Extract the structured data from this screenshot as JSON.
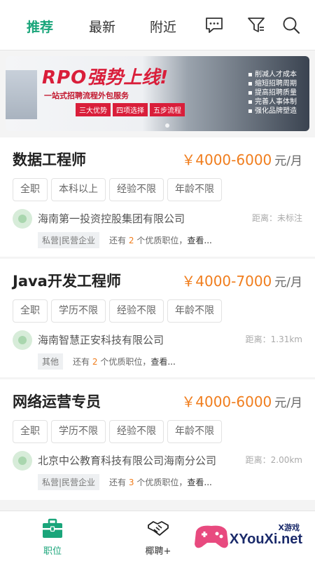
{
  "tabs": [
    {
      "label": "推荐",
      "active": true
    },
    {
      "label": "最新",
      "active": false
    },
    {
      "label": "附近",
      "active": false
    }
  ],
  "toolbar_icons": [
    "chat-icon",
    "filter-icon",
    "search-icon"
  ],
  "banner": {
    "title_latin": "RPO",
    "title_cn": "强势上线!",
    "subtitle": "一站式招聘流程外包服务",
    "pills": [
      "三大优势",
      "四项选择",
      "五步流程"
    ],
    "benefits": [
      "削减人才成本",
      "缩短招聘周期",
      "提高招聘质量",
      "完善人事体制",
      "强化品牌塑造"
    ]
  },
  "jobs": [
    {
      "title": "数据工程师",
      "salary": "￥4000-6000",
      "unit": "元/月",
      "tags": [
        "全职",
        "本科以上",
        "经验不限",
        "年龄不限"
      ],
      "company": "海南第一投资控股集团有限公司",
      "distance": "距离：未标注",
      "type": "私营|民营企业",
      "more_prefix": "还有",
      "more_count": "2",
      "more_suffix": "个优质职位，",
      "more_link": "查看..."
    },
    {
      "title": "Java开发工程师",
      "salary": "￥4000-7000",
      "unit": "元/月",
      "tags": [
        "全职",
        "学历不限",
        "经验不限",
        "年龄不限"
      ],
      "company": "海南智慧正安科技有限公司",
      "distance": "距离：1.31km",
      "type": "其他",
      "more_prefix": "还有",
      "more_count": "2",
      "more_suffix": "个优质职位，",
      "more_link": "查看..."
    },
    {
      "title": "网络运营专员",
      "salary": "￥4000-6000",
      "unit": "元/月",
      "tags": [
        "全职",
        "学历不限",
        "经验不限",
        "年龄不限"
      ],
      "company": "北京中公教育科技有限公司海南分公司",
      "distance": "距离：2.00km",
      "type": "私营|民营企业",
      "more_prefix": "还有",
      "more_count": "3",
      "more_suffix": "个优质职位，",
      "more_link": "查看..."
    }
  ],
  "bottom_nav": [
    {
      "label": "职位",
      "icon": "briefcase-icon",
      "active": true
    },
    {
      "label": "椰聘+",
      "icon": "handshake-icon",
      "active": false
    }
  ],
  "watermark": {
    "small": "X游戏",
    "big": "XYouXi.net"
  },
  "colors": {
    "accent": "#1aa57a",
    "salary": "#f07d1d",
    "banner_red": "#d91e3a"
  }
}
